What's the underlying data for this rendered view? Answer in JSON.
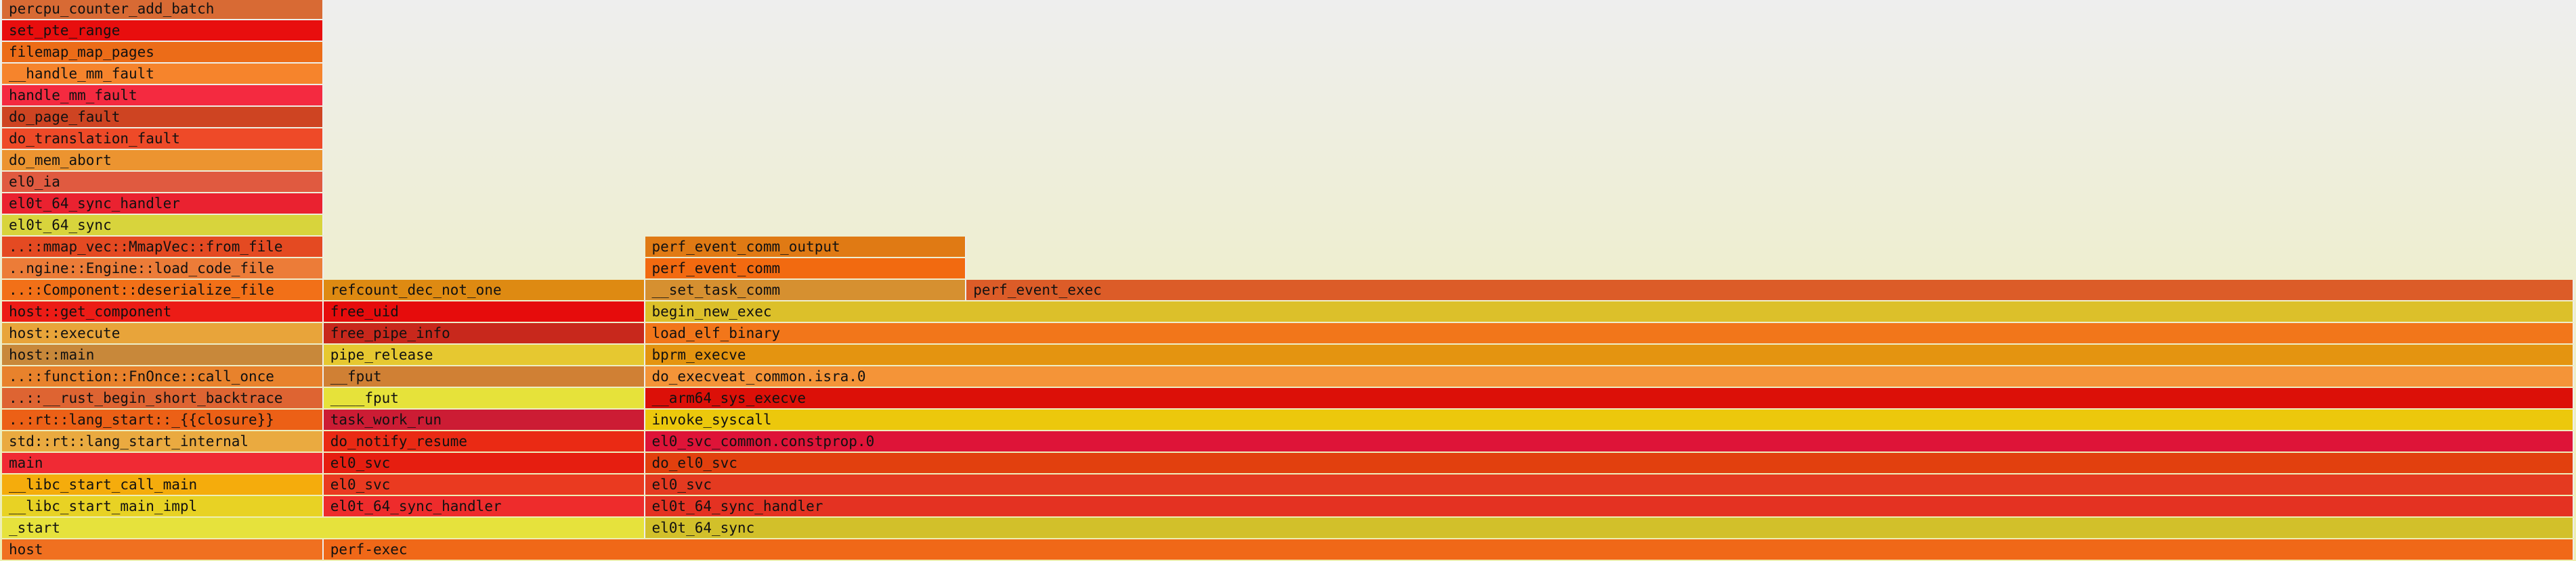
{
  "chart_data": {
    "type": "flamegraph",
    "total_samples": 16,
    "frames": [
      {
        "name": "host",
        "depth": 0,
        "start": 0,
        "width": 2,
        "color": "#f07020"
      },
      {
        "name": "perf-exec",
        "depth": 0,
        "start": 2,
        "width": 14,
        "color": "#f06818"
      },
      {
        "name": "_start",
        "depth": 1,
        "start": 0,
        "width": 4,
        "color": "#e6e23c"
      },
      {
        "name": "el0t_64_sync",
        "depth": 1,
        "start": 4,
        "width": 12,
        "color": "#d2c02a"
      },
      {
        "name": "__libc_start_main_impl",
        "depth": 2,
        "start": 0,
        "width": 2,
        "color": "#e8d224"
      },
      {
        "name": "el0t_64_sync_handler",
        "depth": 2,
        "start": 2,
        "width": 2,
        "color": "#ee2c2c"
      },
      {
        "name": "el0t_64_sync_handler",
        "depth": 2,
        "start": 4,
        "width": 12,
        "color": "#e43222"
      },
      {
        "name": "__libc_start_call_main",
        "depth": 3,
        "start": 0,
        "width": 2,
        "color": "#f5ac0c"
      },
      {
        "name": "el0_svc",
        "depth": 3,
        "start": 2,
        "width": 2,
        "color": "#ea3a20"
      },
      {
        "name": "el0_svc",
        "depth": 3,
        "start": 4,
        "width": 12,
        "color": "#e43a20"
      },
      {
        "name": "main",
        "depth": 4,
        "start": 0,
        "width": 2,
        "color": "#f02a34"
      },
      {
        "name": "el0_svc",
        "depth": 4,
        "start": 2,
        "width": 2,
        "color": "#e61e10"
      },
      {
        "name": "do_el0_svc",
        "depth": 4,
        "start": 4,
        "width": 12,
        "color": "#e2400e"
      },
      {
        "name": "std::rt::lang_start_internal",
        "depth": 5,
        "start": 0,
        "width": 2,
        "color": "#eaaa40"
      },
      {
        "name": "do_notify_resume",
        "depth": 5,
        "start": 2,
        "width": 2,
        "color": "#ea2a14"
      },
      {
        "name": "el0_svc_common.constprop.0",
        "depth": 5,
        "start": 4,
        "width": 12,
        "color": "#de1438"
      },
      {
        "name": "..:rt::lang_start::_{{closure}}",
        "depth": 6,
        "start": 0,
        "width": 2,
        "color": "#ec6016"
      },
      {
        "name": "task_work_run",
        "depth": 6,
        "start": 2,
        "width": 2,
        "color": "#cc1c34"
      },
      {
        "name": "invoke_syscall",
        "depth": 6,
        "start": 4,
        "width": 12,
        "color": "#ecc80c"
      },
      {
        "name": "..::__rust_begin_short_backtrace",
        "depth": 7,
        "start": 0,
        "width": 2,
        "color": "#de6432"
      },
      {
        "name": "____fput",
        "depth": 7,
        "start": 2,
        "width": 2,
        "color": "#e6e23a"
      },
      {
        "name": "__arm64_sys_execve",
        "depth": 7,
        "start": 4,
        "width": 12,
        "color": "#dc1008"
      },
      {
        "name": "..::function::FnOnce::call_once",
        "depth": 8,
        "start": 0,
        "width": 2,
        "color": "#e8822c"
      },
      {
        "name": "__fput",
        "depth": 8,
        "start": 2,
        "width": 2,
        "color": "#d08034"
      },
      {
        "name": "do_execveat_common.isra.0",
        "depth": 8,
        "start": 4,
        "width": 12,
        "color": "#f49438"
      },
      {
        "name": "host::main",
        "depth": 9,
        "start": 0,
        "width": 2,
        "color": "#c8883a"
      },
      {
        "name": "pipe_release",
        "depth": 9,
        "start": 2,
        "width": 2,
        "color": "#e6c830"
      },
      {
        "name": "bprm_execve",
        "depth": 9,
        "start": 4,
        "width": 12,
        "color": "#e49410"
      },
      {
        "name": "host::execute",
        "depth": 10,
        "start": 0,
        "width": 2,
        "color": "#e8a43a"
      },
      {
        "name": "free_pipe_info",
        "depth": 10,
        "start": 2,
        "width": 2,
        "color": "#c8281c"
      },
      {
        "name": "load_elf_binary",
        "depth": 10,
        "start": 4,
        "width": 12,
        "color": "#f2761a"
      },
      {
        "name": "host::get_component",
        "depth": 11,
        "start": 0,
        "width": 2,
        "color": "#ec1c16"
      },
      {
        "name": "free_uid",
        "depth": 11,
        "start": 2,
        "width": 2,
        "color": "#e60c0c"
      },
      {
        "name": "begin_new_exec",
        "depth": 11,
        "start": 4,
        "width": 12,
        "color": "#dcc02a"
      },
      {
        "name": "..::Component::deserialize_file",
        "depth": 12,
        "start": 0,
        "width": 2,
        "color": "#f27018"
      },
      {
        "name": "refcount_dec_not_one",
        "depth": 12,
        "start": 2,
        "width": 2,
        "color": "#de8a12"
      },
      {
        "name": "__set_task_comm",
        "depth": 12,
        "start": 4,
        "width": 2,
        "color": "#d69030"
      },
      {
        "name": "perf_event_exec",
        "depth": 12,
        "start": 6,
        "width": 10,
        "color": "#dc5c28"
      },
      {
        "name": "..ngine::Engine::load_code_file",
        "depth": 13,
        "start": 0,
        "width": 2,
        "color": "#ec7c38"
      },
      {
        "name": "perf_event_comm",
        "depth": 13,
        "start": 4,
        "width": 2,
        "color": "#f26a10"
      },
      {
        "name": "..::mmap_vec::MmapVec::from_file",
        "depth": 14,
        "start": 0,
        "width": 2,
        "color": "#e44a22"
      },
      {
        "name": "perf_event_comm_output",
        "depth": 14,
        "start": 4,
        "width": 2,
        "color": "#e07a14"
      },
      {
        "name": "el0t_64_sync",
        "depth": 15,
        "start": 0,
        "width": 2,
        "color": "#d8d43c"
      },
      {
        "name": "el0t_64_sync_handler",
        "depth": 16,
        "start": 0,
        "width": 2,
        "color": "#ea2230"
      },
      {
        "name": "el0_ia",
        "depth": 17,
        "start": 0,
        "width": 2,
        "color": "#e05a40"
      },
      {
        "name": "do_mem_abort",
        "depth": 18,
        "start": 0,
        "width": 2,
        "color": "#ec9430"
      },
      {
        "name": "do_translation_fault",
        "depth": 19,
        "start": 0,
        "width": 2,
        "color": "#ee4a28"
      },
      {
        "name": "do_page_fault",
        "depth": 20,
        "start": 0,
        "width": 2,
        "color": "#ce4422"
      },
      {
        "name": "handle_mm_fault",
        "depth": 21,
        "start": 0,
        "width": 2,
        "color": "#f42a40"
      },
      {
        "name": "__handle_mm_fault",
        "depth": 22,
        "start": 0,
        "width": 2,
        "color": "#f6842c"
      },
      {
        "name": "filemap_map_pages",
        "depth": 23,
        "start": 0,
        "width": 2,
        "color": "#ec6c18"
      },
      {
        "name": "set_pte_range",
        "depth": 24,
        "start": 0,
        "width": 2,
        "color": "#e80e0e"
      },
      {
        "name": "percpu_counter_add_batch",
        "depth": 25,
        "start": 0,
        "width": 2,
        "color": "#d86a34"
      }
    ]
  }
}
